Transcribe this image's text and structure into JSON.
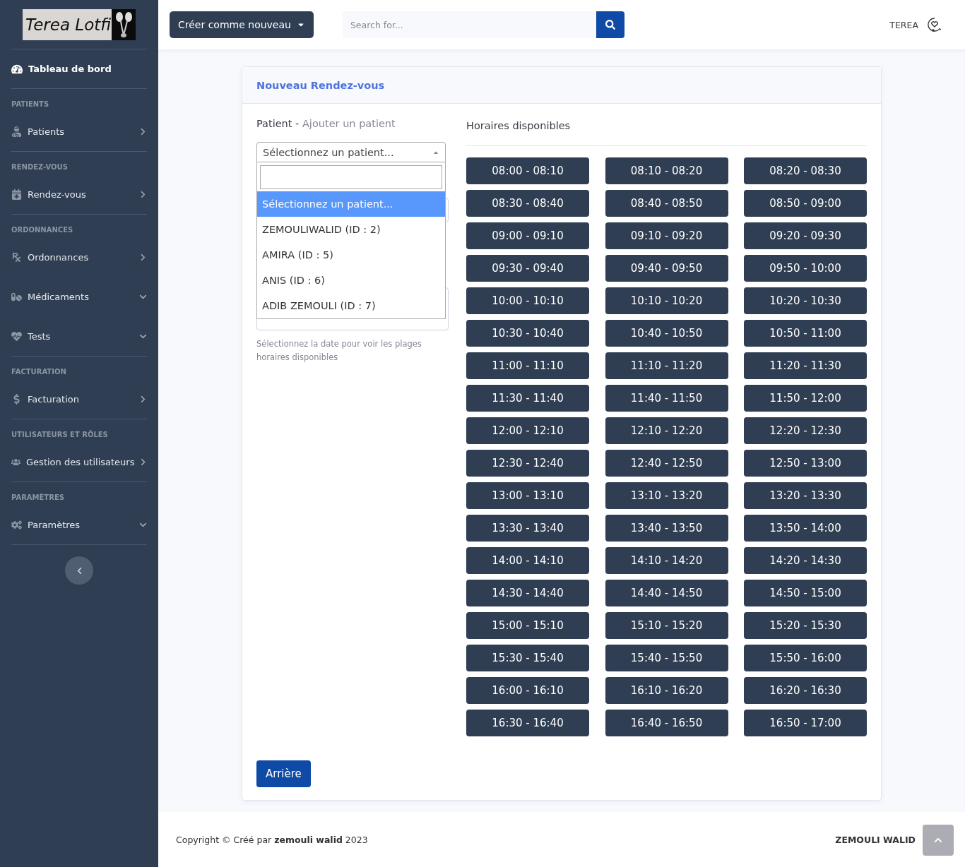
{
  "sidebar": {
    "logo": "Terea Lotfi",
    "dashboard": "Tableau de bord",
    "sections": [
      {
        "heading": "PATIENTS",
        "items": [
          {
            "label": "Patients",
            "kind": "link"
          }
        ]
      },
      {
        "heading": "RENDEZ-VOUS",
        "items": [
          {
            "label": "Rendez-vous",
            "kind": "link"
          }
        ]
      },
      {
        "heading": "ORDONNANCES",
        "items": [
          {
            "label": "Ordonnances",
            "kind": "link"
          },
          {
            "label": "Médicaments",
            "kind": "collapse"
          },
          {
            "label": "Tests",
            "kind": "collapse"
          }
        ]
      },
      {
        "heading": "FACTURATION",
        "items": [
          {
            "label": "Facturation",
            "kind": "link"
          }
        ]
      },
      {
        "heading": "UTILISATEURS ET RÔLES",
        "items": [
          {
            "label": "Gestion des utilisateurs",
            "kind": "link"
          }
        ]
      },
      {
        "heading": "PARAMÈTRES",
        "items": [
          {
            "label": "Paramètres",
            "kind": "collapse"
          }
        ]
      }
    ]
  },
  "topbar": {
    "create_button": "Créer comme nouveau",
    "search": {
      "placeholder": "Search for..."
    },
    "user": "TEREA"
  },
  "card": {
    "title": "Nouveau Rendez-vous",
    "patient_label": "Patient",
    "patient_separator": " - ",
    "add_patient_link": "Ajouter un patient",
    "select": {
      "value": "Sélectionnez un patient...",
      "options": [
        {
          "label": "Sélectionnez un patient...",
          "selected": true
        },
        {
          "label": "ZEMOULIWALID (ID : 2)",
          "selected": false
        },
        {
          "label": "AMIRA (ID : 5)",
          "selected": false
        },
        {
          "label": "ANIS (ID : 6)",
          "selected": false
        },
        {
          "label": "ADIB ZEMOULI (ID : 7)",
          "selected": false
        }
      ]
    },
    "help": "Sélectionnez la date pour voir les plages horaires disponibles",
    "slots_title": "Horaires disponibles",
    "slots": [
      "08:00 - 08:10",
      "08:10 - 08:20",
      "08:20 - 08:30",
      "08:30 - 08:40",
      "08:40 - 08:50",
      "08:50 - 09:00",
      "09:00 - 09:10",
      "09:10 - 09:20",
      "09:20 - 09:30",
      "09:30 - 09:40",
      "09:40 - 09:50",
      "09:50 - 10:00",
      "10:00 - 10:10",
      "10:10 - 10:20",
      "10:20 - 10:30",
      "10:30 - 10:40",
      "10:40 - 10:50",
      "10:50 - 11:00",
      "11:00 - 11:10",
      "11:10 - 11:20",
      "11:20 - 11:30",
      "11:30 - 11:40",
      "11:40 - 11:50",
      "11:50 - 12:00",
      "12:00 - 12:10",
      "12:10 - 12:20",
      "12:20 - 12:30",
      "12:30 - 12:40",
      "12:40 - 12:50",
      "12:50 - 13:00",
      "13:00 - 13:10",
      "13:10 - 13:20",
      "13:20 - 13:30",
      "13:30 - 13:40",
      "13:40 - 13:50",
      "13:50 - 14:00",
      "14:00 - 14:10",
      "14:10 - 14:20",
      "14:20 - 14:30",
      "14:30 - 14:40",
      "14:40 - 14:50",
      "14:50 - 15:00",
      "15:00 - 15:10",
      "15:10 - 15:20",
      "15:20 - 15:30",
      "15:30 - 15:40",
      "15:40 - 15:50",
      "15:50 - 16:00",
      "16:00 - 16:10",
      "16:10 - 16:20",
      "16:20 - 16:30",
      "16:30 - 16:40",
      "16:40 - 16:50",
      "16:50 - 17:00"
    ],
    "back_button": "Arrière"
  },
  "footer": {
    "copyright": "Copyright © Créé par **zemouli walid** 2023",
    "author": "ZEMOULI WALID"
  }
}
